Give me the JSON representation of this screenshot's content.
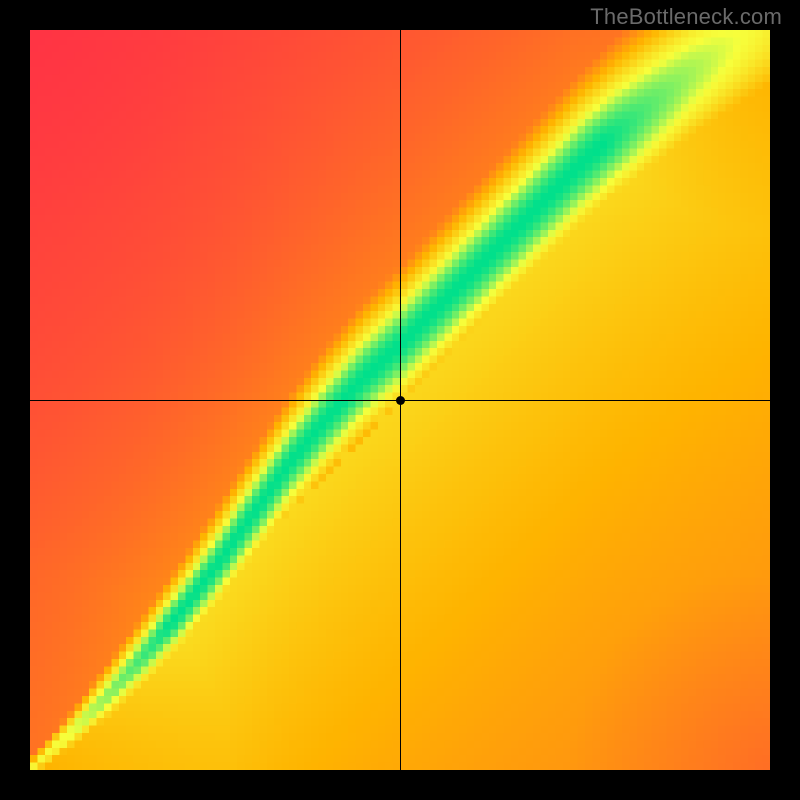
{
  "watermark": "TheBottleneck.com",
  "chart_data": {
    "type": "heatmap",
    "title": "",
    "xlabel": "",
    "ylabel": "",
    "xlim": [
      0,
      1
    ],
    "ylim": [
      0,
      1
    ],
    "grid": false,
    "legend": false,
    "marker": {
      "x": 0.5,
      "y": 0.5
    },
    "crosshair": {
      "x": 0.5,
      "y": 0.5
    },
    "ridge": [
      {
        "x": 0.0,
        "y": 0.0,
        "width": 0.01
      },
      {
        "x": 0.05,
        "y": 0.045,
        "width": 0.018
      },
      {
        "x": 0.1,
        "y": 0.095,
        "width": 0.028
      },
      {
        "x": 0.15,
        "y": 0.15,
        "width": 0.035
      },
      {
        "x": 0.2,
        "y": 0.21,
        "width": 0.042
      },
      {
        "x": 0.25,
        "y": 0.275,
        "width": 0.048
      },
      {
        "x": 0.3,
        "y": 0.345,
        "width": 0.052
      },
      {
        "x": 0.35,
        "y": 0.415,
        "width": 0.056
      },
      {
        "x": 0.4,
        "y": 0.475,
        "width": 0.06
      },
      {
        "x": 0.45,
        "y": 0.53,
        "width": 0.062
      },
      {
        "x": 0.5,
        "y": 0.575,
        "width": 0.064
      },
      {
        "x": 0.55,
        "y": 0.625,
        "width": 0.066
      },
      {
        "x": 0.6,
        "y": 0.675,
        "width": 0.068
      },
      {
        "x": 0.65,
        "y": 0.725,
        "width": 0.07
      },
      {
        "x": 0.7,
        "y": 0.775,
        "width": 0.072
      },
      {
        "x": 0.75,
        "y": 0.825,
        "width": 0.074
      },
      {
        "x": 0.8,
        "y": 0.87,
        "width": 0.076
      },
      {
        "x": 0.85,
        "y": 0.91,
        "width": 0.078
      },
      {
        "x": 0.9,
        "y": 0.95,
        "width": 0.08
      },
      {
        "x": 0.95,
        "y": 0.985,
        "width": 0.082
      },
      {
        "x": 1.0,
        "y": 1.02,
        "width": 0.084
      }
    ],
    "colorscale": {
      "min_color": "#ff2a4a",
      "mid1_color": "#ffb400",
      "mid2_color": "#f7ff3c",
      "max_color": "#00e08c"
    },
    "resolution": 100
  }
}
